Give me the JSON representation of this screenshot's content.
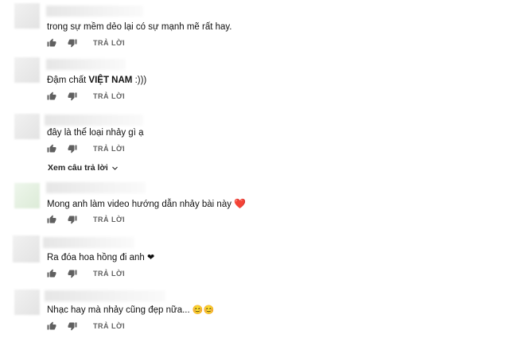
{
  "reply_label": "TRẢ LỜI",
  "view_replies_label": "Xem câu trả lời",
  "comments": [
    {
      "text": "trong sự mềm dẻo lại có sự mạnh mẽ rất hay."
    },
    {
      "text_prefix": "Đậm chất ",
      "text_bold": "VIỆT NAM",
      "text_suffix": " :)))"
    },
    {
      "text": "đây là thể loại nhảy gì ạ"
    },
    {
      "text": "Mong anh làm video hướng dẫn nhảy bài này",
      "emoji": "❤️"
    },
    {
      "text": "Ra đóa hoa hồng đi anh",
      "emoji": "❤"
    },
    {
      "text": "Nhạc hay mà nhảy cũng đẹp nữa...",
      "emoji": "😊😊"
    }
  ],
  "icons": {
    "like": "thumb-up-icon",
    "dislike": "thumb-down-icon",
    "expand": "chevron-down-icon"
  }
}
